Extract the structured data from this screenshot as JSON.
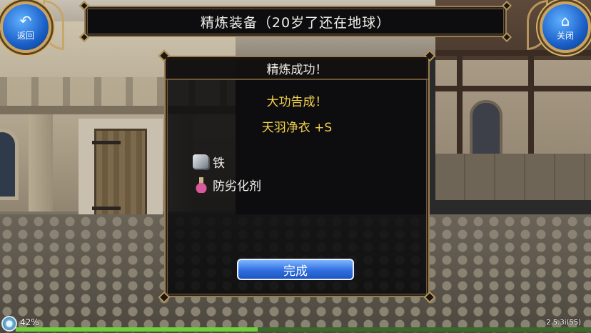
{
  "header": {
    "title": "精炼装备（20岁了还在地球）",
    "back_label": "返回",
    "close_label": "关闭"
  },
  "dialog": {
    "title": "精炼成功！",
    "result_line_1": "大功告成！",
    "result_line_2": "天羽净衣 +S",
    "materials": [
      {
        "icon": "iron-ore-icon",
        "label": "铁"
      },
      {
        "icon": "potion-icon",
        "label": "防劣化剂"
      }
    ],
    "done_label": "完成"
  },
  "status": {
    "progress_percent": "42%",
    "progress_value": 42,
    "version": "2.5.3i(55)"
  },
  "colors": {
    "title_text": "#f0eee8",
    "success_text": "#f2d24a",
    "button_blue": "#2f6fe0",
    "frame_gold": "#9a7d52"
  }
}
